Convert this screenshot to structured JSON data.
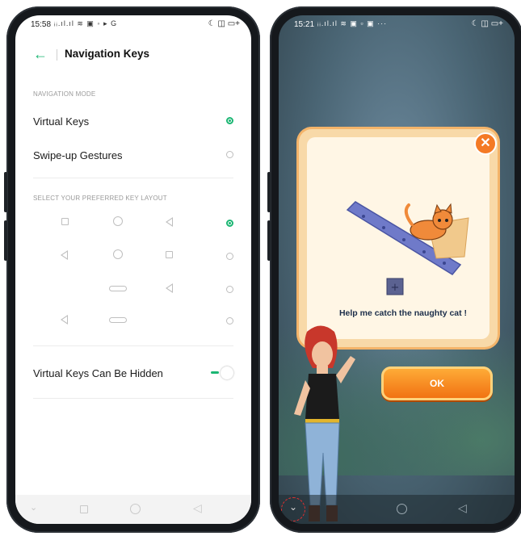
{
  "left_phone": {
    "status": {
      "time": "15:58",
      "icons_left": "ᵢᵢ.ıl.ıl ≋ ▣ ◦ ▸ G",
      "icons_right": "☾ ◫ ▭+"
    },
    "header": {
      "back_icon": "arrow-left-icon",
      "title": "Navigation Keys"
    },
    "section_mode": "NAVIGATION MODE",
    "modes": [
      {
        "label": "Virtual Keys",
        "selected": true
      },
      {
        "label": "Swipe-up Gestures",
        "selected": false
      }
    ],
    "section_layout": "SELECT YOUR PREFERRED KEY LAYOUT",
    "layouts": [
      {
        "keys": [
          "square",
          "circle",
          "triangle"
        ],
        "selected": true
      },
      {
        "keys": [
          "triangle",
          "circle",
          "square"
        ],
        "selected": false
      },
      {
        "keys": [
          "",
          "pill",
          "triangle"
        ],
        "selected": false
      },
      {
        "keys": [
          "triangle",
          "pill",
          ""
        ],
        "selected": false
      }
    ],
    "hidden_toggle": {
      "label": "Virtual Keys Can Be Hidden",
      "on": true
    },
    "accent": "#1bb673"
  },
  "right_phone": {
    "status": {
      "time": "15:21",
      "icons_left": "ᵢᵢ.ıl.ıl ≋ ▣ ▫ ▣ ···",
      "icons_right": "☾ ◫ ▭+"
    },
    "dialog": {
      "message": "Help me catch the naughty cat !",
      "close_icon": "close-icon"
    },
    "ok_label": "OK",
    "accent": "#f47a25"
  }
}
